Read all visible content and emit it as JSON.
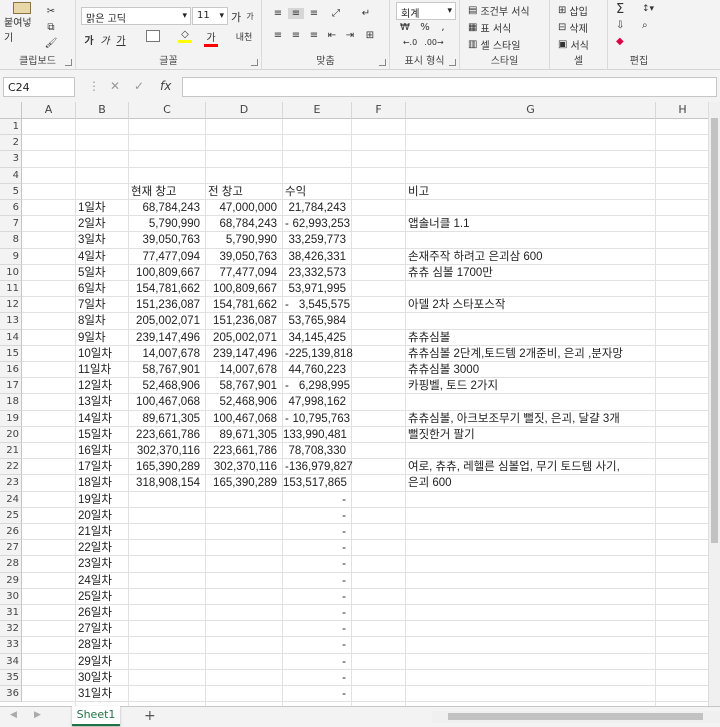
{
  "ribbon": {
    "clipboard": {
      "paste": "붙여넣기",
      "label": "클립보드"
    },
    "font": {
      "name": "맑은 고딕",
      "size": "11",
      "grow": "가",
      "shrink": "가",
      "bold": "가",
      "italic": "가",
      "underline": "가",
      "fill_color": "#ffff00",
      "font_color": "#ff0000",
      "label": "글꼴"
    },
    "align": {
      "label": "맞춤"
    },
    "number": {
      "format": "회계",
      "percent": "%",
      "comma": ",",
      "label": "표시 형식"
    },
    "style": {
      "conditional": "조건부 서식",
      "table": "표 서식",
      "cell_style": "셀 스타일",
      "label": "스타일"
    },
    "cells": {
      "insert": "삽입",
      "delete": "삭제",
      "format": "서식",
      "label": "셀"
    },
    "editing": {
      "label": "편집"
    }
  },
  "formula_bar": {
    "name_box": "C24",
    "value": ""
  },
  "columns": [
    "A",
    "B",
    "C",
    "D",
    "E",
    "F",
    "G",
    "H"
  ],
  "rows": [
    {
      "n": "1"
    },
    {
      "n": "2"
    },
    {
      "n": "3"
    },
    {
      "n": "4"
    },
    {
      "n": "5",
      "c": "현재 창고",
      "d": "전 창고",
      "e": "수익",
      "g": "비고"
    },
    {
      "n": "6",
      "b": "1일차",
      "c": "68,784,243",
      "d": "47,000,000",
      "e": "21,784,243"
    },
    {
      "n": "7",
      "b": "2일차",
      "c": "5,790,990",
      "d": "68,784,243",
      "e": "-62,993,253",
      "g": "앱솔너클 1.1"
    },
    {
      "n": "8",
      "b": "3일차",
      "c": "39,050,763",
      "d": "5,790,990",
      "e": "33,259,773"
    },
    {
      "n": "9",
      "b": "4일차",
      "c": "77,477,094",
      "d": "39,050,763",
      "e": "38,426,331",
      "g": "손재주작 하려고 은괴삼 600"
    },
    {
      "n": "10",
      "b": "5일차",
      "c": "100,809,667",
      "d": "77,477,094",
      "e": "23,332,573",
      "g": "츄츄 심볼 1700만"
    },
    {
      "n": "11",
      "b": "6일차",
      "c": "154,781,662",
      "d": "100,809,667",
      "e": "53,971,995"
    },
    {
      "n": "12",
      "b": "7일차",
      "c": "151,236,087",
      "d": "154,781,662",
      "e": "-3,545,575",
      "g": "아델 2차 스타포스작"
    },
    {
      "n": "13",
      "b": "8일차",
      "c": "205,002,071",
      "d": "151,236,087",
      "e": "53,765,984"
    },
    {
      "n": "14",
      "b": "9일차",
      "c": "239,147,496",
      "d": "205,002,071",
      "e": "34,145,425",
      "g": "츄츄심볼"
    },
    {
      "n": "15",
      "b": "10일차",
      "c": "14,007,678",
      "d": "239,147,496",
      "e": "-225,139,818",
      "g": "츄츄심볼 2단계,토드템 2개준비, 은괴 ,분자망"
    },
    {
      "n": "16",
      "b": "11일차",
      "c": "58,767,901",
      "d": "14,007,678",
      "e": "44,760,223",
      "g": "츄츄심볼 3000"
    },
    {
      "n": "17",
      "b": "12일차",
      "c": "52,468,906",
      "d": "58,767,901",
      "e": "-6,298,995",
      "g": "카핑벨, 토드 2가지"
    },
    {
      "n": "18",
      "b": "13일차",
      "c": "100,467,068",
      "d": "52,468,906",
      "e": "47,998,162"
    },
    {
      "n": "19",
      "b": "14일차",
      "c": "89,671,305",
      "d": "100,467,068",
      "e": "-10,795,763",
      "g": "츄츄심볼, 아크보조무기 뻘짓, 은괴, 달걀 3개"
    },
    {
      "n": "20",
      "b": "15일차",
      "c": "223,661,786",
      "d": "89,671,305",
      "e": "133,990,481",
      "g": "뻘짓한거 팔기"
    },
    {
      "n": "21",
      "b": "16일차",
      "c": "302,370,116",
      "d": "223,661,786",
      "e": "78,708,330"
    },
    {
      "n": "22",
      "b": "17일차",
      "c": "165,390,289",
      "d": "302,370,116",
      "e": "-136,979,827",
      "g": "여로, 츄츄, 레헬른 심볼업, 무기 토드템 사기,"
    },
    {
      "n": "23",
      "b": "18일차",
      "c": "318,908,154",
      "d": "165,390,289",
      "e": "153,517,865",
      "g": "은괴 600"
    },
    {
      "n": "24",
      "b": "19일차",
      "e": "-"
    },
    {
      "n": "25",
      "b": "20일차",
      "e": "-"
    },
    {
      "n": "26",
      "b": "21일차",
      "e": "-"
    },
    {
      "n": "27",
      "b": "22일차",
      "e": "-"
    },
    {
      "n": "28",
      "b": "23일차",
      "e": "-"
    },
    {
      "n": "29",
      "b": "24일차",
      "e": "-"
    },
    {
      "n": "30",
      "b": "25일차",
      "e": "-"
    },
    {
      "n": "31",
      "b": "26일차",
      "e": "-"
    },
    {
      "n": "32",
      "b": "27일차",
      "e": "-"
    },
    {
      "n": "33",
      "b": "28일차",
      "e": "-"
    },
    {
      "n": "34",
      "b": "29일차",
      "e": "-"
    },
    {
      "n": "35",
      "b": "30일차",
      "e": "-"
    },
    {
      "n": "36",
      "b": "31일차",
      "e": "-"
    }
  ],
  "sheet_tab": "Sheet1",
  "add_sheet": "+"
}
